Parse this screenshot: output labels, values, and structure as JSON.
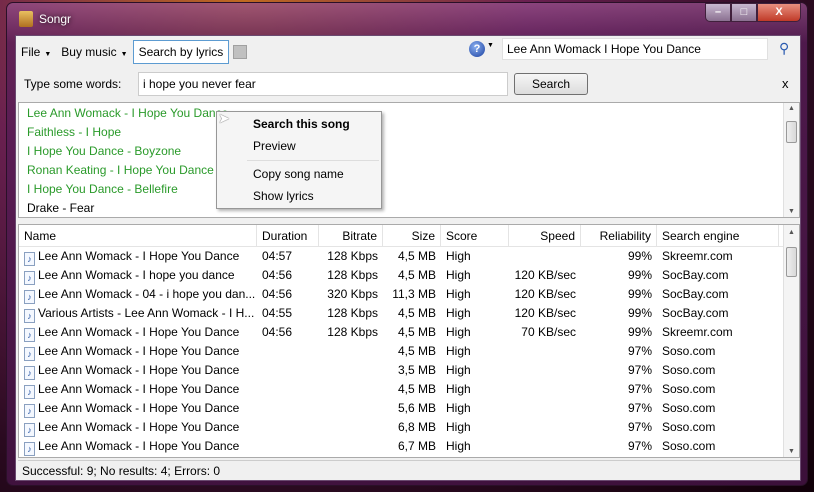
{
  "window": {
    "title": "Songr"
  },
  "toolbar": {
    "file": "File",
    "buy_music": "Buy music",
    "search_by_lyrics": "Search by lyrics",
    "help": "?",
    "search_value": "Lee Ann Womack  I Hope You Dance"
  },
  "lyrics_bar": {
    "label": "Type some words:",
    "value": "i hope you never fear",
    "search_button": "Search",
    "close": "x"
  },
  "lyric_results": [
    {
      "text": "Lee Ann Womack - I Hope You Dance",
      "found": true
    },
    {
      "text": "Faithless - I Hope",
      "found": true
    },
    {
      "text": "I Hope You Dance  - Boyzone",
      "found": true
    },
    {
      "text": "Ronan Keating - I Hope You Dance",
      "found": true
    },
    {
      "text": "I Hope You Dance  - Bellefire",
      "found": true
    },
    {
      "text": "Drake - Fear",
      "found": false
    }
  ],
  "context_menu": {
    "items": [
      "Search this song",
      "Preview",
      "Copy song name",
      "Show lyrics"
    ]
  },
  "table": {
    "columns": [
      "Name",
      "Duration",
      "Bitrate",
      "Size",
      "Score",
      "Speed",
      "Reliability",
      "Search engine"
    ],
    "rows": [
      [
        "Lee Ann Womack - I Hope You Dance",
        "04:57",
        "128 Kbps",
        "4,5 MB",
        "High",
        "",
        "99%",
        "Skreemr.com"
      ],
      [
        "Lee Ann Womack - I hope you dance",
        "04:56",
        "128 Kbps",
        "4,5 MB",
        "High",
        "120 KB/sec",
        "99%",
        "SocBay.com"
      ],
      [
        "Lee Ann Womack - 04 - i hope you dan...",
        "04:56",
        "320 Kbps",
        "11,3 MB",
        "High",
        "120 KB/sec",
        "99%",
        "SocBay.com"
      ],
      [
        "Various Artists - Lee Ann Womack - I H...",
        "04:55",
        "128 Kbps",
        "4,5 MB",
        "High",
        "120 KB/sec",
        "99%",
        "SocBay.com"
      ],
      [
        "Lee Ann Womack - I Hope You Dance",
        "04:56",
        "128 Kbps",
        "4,5 MB",
        "High",
        "70 KB/sec",
        "99%",
        "Skreemr.com"
      ],
      [
        "Lee Ann Womack - I Hope You Dance",
        "",
        "",
        "4,5 MB",
        "High",
        "",
        "97%",
        "Soso.com"
      ],
      [
        "Lee Ann Womack - I Hope You Dance",
        "",
        "",
        "3,5 MB",
        "High",
        "",
        "97%",
        "Soso.com"
      ],
      [
        "Lee Ann Womack - I Hope You Dance",
        "",
        "",
        "4,5 MB",
        "High",
        "",
        "97%",
        "Soso.com"
      ],
      [
        "Lee Ann Womack - I Hope You Dance",
        "",
        "",
        "5,6 MB",
        "High",
        "",
        "97%",
        "Soso.com"
      ],
      [
        "Lee Ann Womack - I Hope You Dance",
        "",
        "",
        "6,8 MB",
        "High",
        "",
        "97%",
        "Soso.com"
      ],
      [
        "Lee Ann Womack - I Hope You Dance",
        "",
        "",
        "6,7 MB",
        "High",
        "",
        "97%",
        "Soso.com"
      ]
    ]
  },
  "status": "Successful: 9; No results: 4; Errors: 0"
}
